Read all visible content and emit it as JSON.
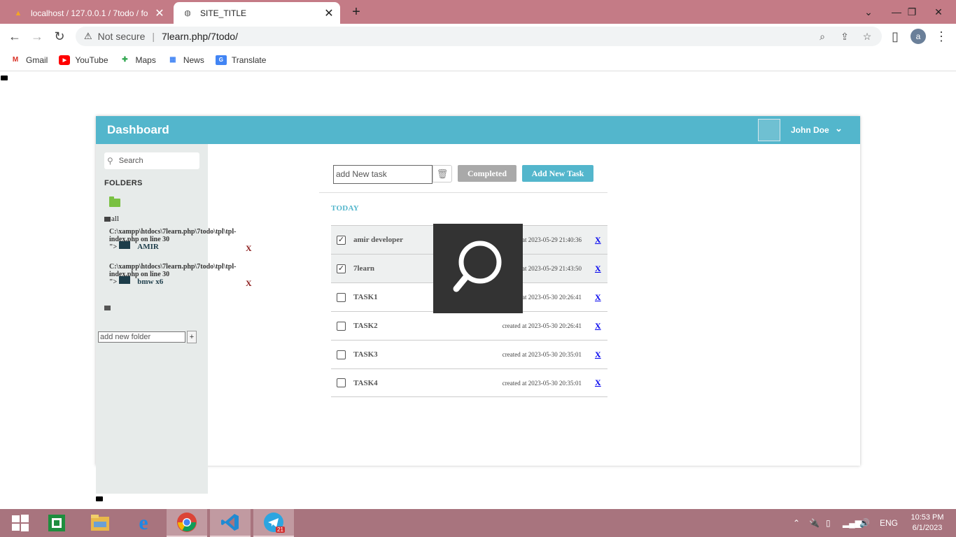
{
  "browser": {
    "tabs": [
      {
        "title": "localhost / 127.0.0.1 / 7todo / fo",
        "active": false
      },
      {
        "title": "SITE_TITLE",
        "active": true
      }
    ],
    "address": {
      "security": "Not secure",
      "url": "7learn.php/7todo/"
    },
    "profile_initial": "a",
    "bookmarks": [
      "Gmail",
      "YouTube",
      "Maps",
      "News",
      "Translate"
    ]
  },
  "app": {
    "title": "Dashboard",
    "user_name": "John Doe",
    "search_placeholder": "Search",
    "folders_heading": "FOLDERS",
    "all_label": "all",
    "folders": [
      {
        "error_text": "C:\\xampp\\htdocs\\7learn.php\\7todo\\tpl\\tpl-index.php on line 30",
        "prefix": "\">",
        "name": "AMIR",
        "delete": "X"
      },
      {
        "error_text": "C:\\xampp\\htdocs\\7learn.php\\7todo\\tpl\\tpl-index.php on line 30",
        "prefix": "\">",
        "name": "bmw x6",
        "delete": "X"
      }
    ],
    "add_folder_placeholder": "add new folder",
    "add_folder_btn": "+",
    "add_task_placeholder": "add New task",
    "completed_btn": "Completed",
    "add_task_btn": "Add New Task",
    "section_today": "TODAY",
    "tasks": [
      {
        "name": "amir developer",
        "created": "created at 2023-05-29 21:40:36",
        "done": true,
        "delete": "X"
      },
      {
        "name": "7learn",
        "created": "created at 2023-05-29 21:43:50",
        "done": true,
        "delete": "X"
      },
      {
        "name": "TASK1",
        "created": "created at 2023-05-30 20:26:41",
        "done": false,
        "delete": "X"
      },
      {
        "name": "TASK2",
        "created": "created at 2023-05-30 20:26:41",
        "done": false,
        "delete": "X"
      },
      {
        "name": "TASK3",
        "created": "created at 2023-05-30 20:35:01",
        "done": false,
        "delete": "X"
      },
      {
        "name": "TASK4",
        "created": "created at 2023-05-30 20:35:01",
        "done": false,
        "delete": "X"
      }
    ]
  },
  "taskbar": {
    "apps": [
      "start",
      "excel",
      "file-explorer",
      "internet-explorer",
      "chrome",
      "vscode",
      "telegram"
    ],
    "telegram_badge": "21",
    "language": "ENG",
    "time": "10:53 PM",
    "date": "6/1/2023"
  },
  "colors": {
    "accent": "#53b6cc",
    "tabbar": "#c47b86",
    "taskbar": "#a8747e",
    "sidebar": "#e7ebea"
  }
}
